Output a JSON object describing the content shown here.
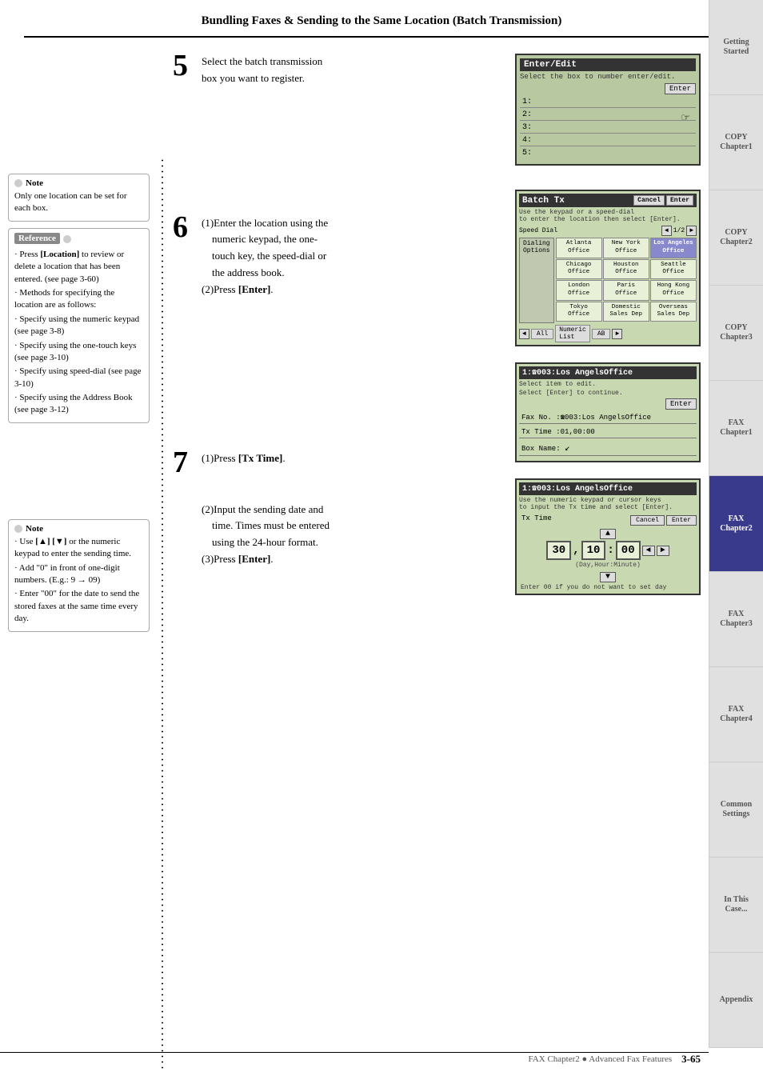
{
  "page": {
    "title": "Bundling Faxes & Sending to the Same Location (Batch Transmission)",
    "footer_text": "FAX Chapter2 ● Advanced Fax Features",
    "footer_page": "3-65"
  },
  "sidebar": {
    "tabs": [
      {
        "label": "Getting\nStarted",
        "active": false
      },
      {
        "label": "COPY\nChapter1",
        "active": false
      },
      {
        "label": "COPY\nChapter2",
        "active": false
      },
      {
        "label": "COPY\nChapter3",
        "active": false
      },
      {
        "label": "FAX\nChapter1",
        "active": false
      },
      {
        "label": "FAX\nChapter2",
        "active": true
      },
      {
        "label": "FAX\nChapter3",
        "active": false
      },
      {
        "label": "FAX\nChapter4",
        "active": false
      },
      {
        "label": "Common\nSettings",
        "active": false
      },
      {
        "label": "In This\nCase...",
        "active": false
      },
      {
        "label": "Appendix",
        "active": false
      }
    ]
  },
  "left_column": {
    "note1": {
      "title": "Note",
      "body": "Only one location can be set for each box."
    },
    "reference": {
      "title": "Reference",
      "items": [
        "Press [Location] to review or delete a location that has been entered. (see page 3-60)",
        "Methods for specifying the location are as follows:",
        "Specify using the numeric keypad (see page 3-8)",
        "Specify using the one-touch keys (see page 3-10)",
        "Specify using speed-dial (see page 3-10)",
        "Specify using the Address Book (see page 3-12)"
      ]
    },
    "note2": {
      "title": "Note",
      "items": [
        "Use [▲] [▼] or the numeric keypad to enter the sending time.",
        "Add \"0\" in front of one-digit numbers. (E.g.: 9 → 09)",
        "Enter \"00\" for the date to send the stored faxes at the same time every day."
      ]
    }
  },
  "steps": [
    {
      "number": "5",
      "text_parts": [
        {
          "text": "Select the batch transmission box you want to register.",
          "bold": false
        }
      ]
    },
    {
      "number": "6",
      "text_parts": [
        {
          "text": "(1)Enter the location using the numeric keypad, the one-touch key, the speed-dial or the address book.",
          "bold": false
        },
        {
          "text": "(2)Press ",
          "bold": false
        },
        {
          "text": "[Enter]",
          "bold": true
        },
        {
          "text": ".",
          "bold": false
        }
      ]
    },
    {
      "number": "7",
      "text_parts": [
        {
          "text": "(1)Press ",
          "bold": false
        },
        {
          "text": "[Tx Time]",
          "bold": true
        },
        {
          "text": ".",
          "bold": false
        }
      ]
    },
    {
      "number": "",
      "text_parts": [
        {
          "text": "(2)Input the sending date and time. Times must be entered using the 24-hour format.",
          "bold": false
        },
        {
          "text": "(3)Press ",
          "bold": false
        },
        {
          "text": "[Enter]",
          "bold": true
        },
        {
          "text": ".",
          "bold": false
        }
      ]
    }
  ],
  "screens": {
    "enter_edit": {
      "title": "Enter/Edit",
      "subtitle": "Select the box to number enter/edit.",
      "btn": "Enter",
      "lines": [
        "1:",
        "2:",
        "3:",
        "4:",
        "5:"
      ]
    },
    "batch_tx": {
      "title": "Batch Tx",
      "subtitle": "Use the keypad or a speed-dial to enter the location then select [Enter].",
      "buttons": [
        "Cancel",
        "Enter"
      ],
      "speed_dial_label": "Speed Dial",
      "dialing_options_label": "Dialing Options",
      "page_label": "1/2",
      "grid_cells": [
        "Atlanta\nOffice",
        "New York\nOffice",
        "Los Angeles\nOffice",
        "Chicago\nOffice",
        "Houston\nOffice",
        "Seattle\nOffice",
        "London\nOffice",
        "Paris\nOffice",
        "Hong Kong\nOffice",
        "Tokyo\nOffice",
        "Domestic\nSales Dep",
        "Overseas\nSales Dep"
      ],
      "bottom_tabs": [
        "All",
        "Numeric\nList",
        "AB"
      ]
    },
    "los_angeles_detail": {
      "title": "1:✆003:Los AngelsOffice",
      "subtitle1": "Select item to edit.",
      "subtitle2": "Select [Enter] to continue.",
      "btn": "Enter",
      "fields": [
        "Fax No. :☎003:Los AngelsOffice",
        "Tx Time :01,00:00",
        "Box Name:"
      ]
    },
    "time_input": {
      "title": "1:✆003:Los AngelsOffice",
      "subtitle": "Use the numeric keypad or cursor keys to input the Tx time and select [Enter].",
      "tx_time_label": "Tx Time",
      "buttons": [
        "Cancel",
        "Enter"
      ],
      "time_display": {
        "day": "30",
        "hour": "10",
        "minute": "00"
      },
      "day_hour_minute_label": "(Day,Hour:Minute)",
      "note": "Enter 00 if you do not want to set day",
      "up_btn": "▲",
      "down_btn": "▼",
      "left_btn": "◄",
      "right_btn": "►"
    }
  }
}
